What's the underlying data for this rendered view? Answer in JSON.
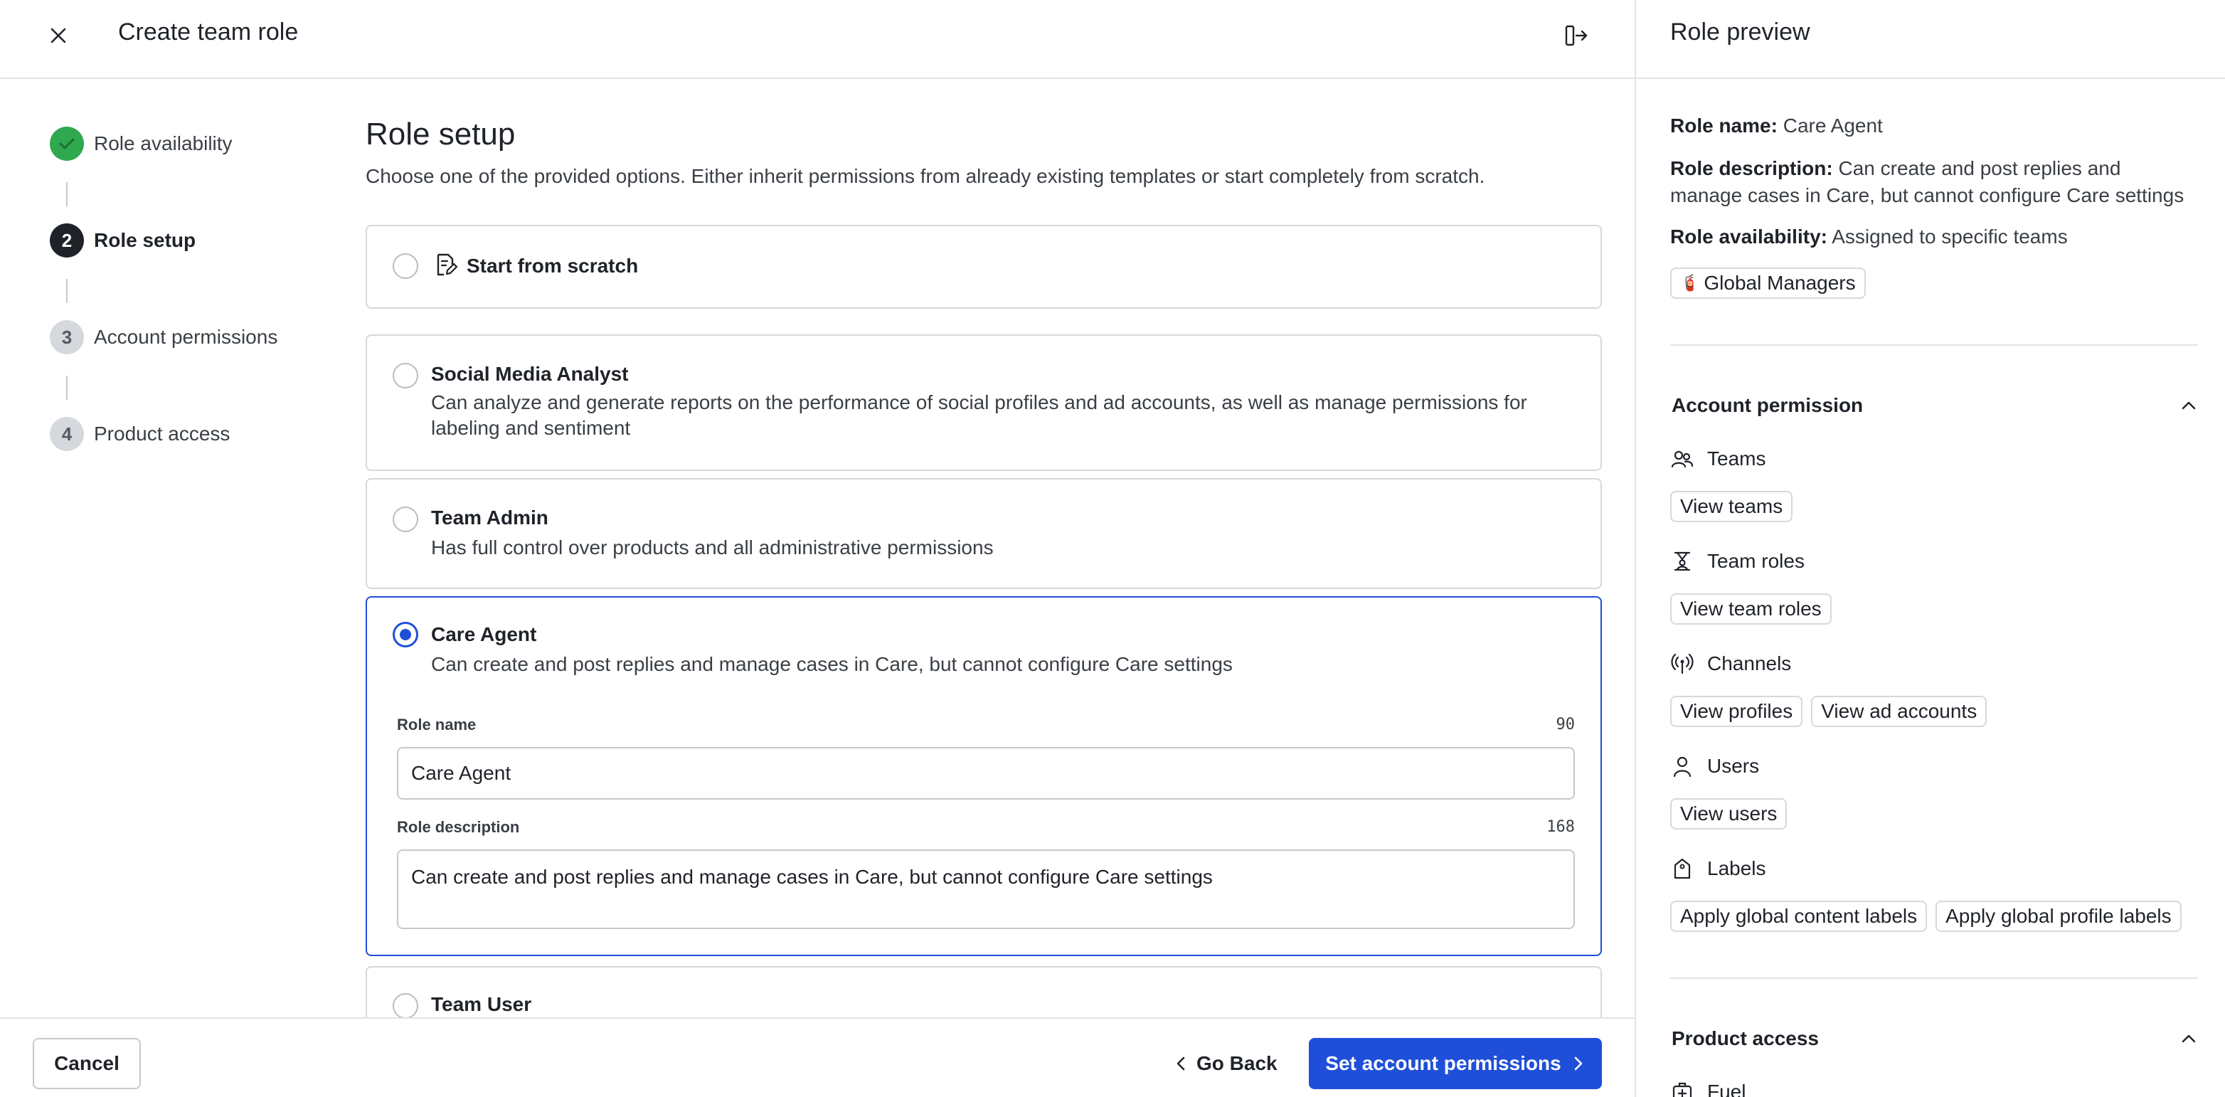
{
  "header": {
    "title": "Create team role"
  },
  "stepper": {
    "steps": [
      {
        "number": "",
        "label": "Role availability",
        "state": "done"
      },
      {
        "number": "2",
        "label": "Role setup",
        "state": "active"
      },
      {
        "number": "3",
        "label": "Account permissions",
        "state": "todo"
      },
      {
        "number": "4",
        "label": "Product access",
        "state": "todo"
      }
    ]
  },
  "main": {
    "title": "Role setup",
    "description": "Choose one of the provided options. Either inherit permissions from already existing templates or start completely from scratch.",
    "options": [
      {
        "title": "Start from scratch",
        "description": "",
        "selected": false
      },
      {
        "title": "Social Media Analyst",
        "description": "Can analyze and generate reports on the performance of social profiles and ad accounts, as well as manage permissions for labeling and sentiment",
        "selected": false
      },
      {
        "title": "Team Admin",
        "description": "Has full control over products and all administrative permissions",
        "selected": false
      },
      {
        "title": "Care Agent",
        "description": "Can create and post replies and manage cases in Care, but cannot configure Care settings",
        "selected": true
      },
      {
        "title": "Team User",
        "description": "",
        "selected": false
      }
    ],
    "form": {
      "role_name_label": "Role name",
      "role_name_count": "90",
      "role_name_value": "Care Agent",
      "role_description_label": "Role description",
      "role_description_count": "168",
      "role_description_value": "Can create and post replies and manage cases in Care, but cannot configure Care settings"
    }
  },
  "footer": {
    "cancel_label": "Cancel",
    "back_label": "Go Back",
    "next_label": "Set account permissions"
  },
  "preview": {
    "title": "Role preview",
    "role_name_key": "Role name:",
    "role_name_value": "Care Agent",
    "role_description_key": "Role description:",
    "role_description_value": "Can create and post replies and manage cases in Care, but cannot configure Care settings",
    "role_availability_key": "Role availability:",
    "role_availability_value": "Assigned to specific teams",
    "team_chip": "Global Managers",
    "team_chip_emoji": "🧯",
    "account_permission": {
      "title": "Account permission",
      "groups": [
        {
          "name": "Teams",
          "icon": "teams-icon",
          "chips": [
            "View teams"
          ]
        },
        {
          "name": "Team roles",
          "icon": "team-roles-icon",
          "chips": [
            "View team roles"
          ]
        },
        {
          "name": "Channels",
          "icon": "channels-icon",
          "chips": [
            "View profiles",
            "View ad accounts"
          ]
        },
        {
          "name": "Users",
          "icon": "users-icon",
          "chips": [
            "View users"
          ]
        },
        {
          "name": "Labels",
          "icon": "labels-icon",
          "chips": [
            "Apply global content labels",
            "Apply global profile labels"
          ]
        }
      ]
    },
    "product_access": {
      "title": "Product access",
      "first_item": "Fuel"
    }
  },
  "colors": {
    "accent": "#1f4fd9",
    "success": "#2fa84f",
    "border": "#d5d8dc"
  }
}
